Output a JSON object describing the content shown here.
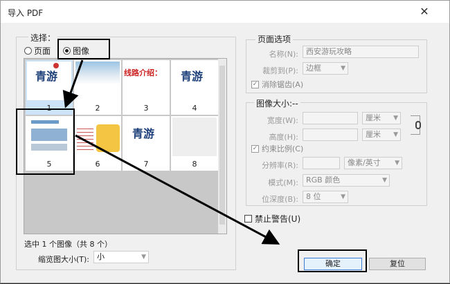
{
  "window": {
    "title": "导入 PDF",
    "close": "✕"
  },
  "select": {
    "group_label": "选择：",
    "page_label": "页面",
    "image_label": "图像",
    "image_selected": true
  },
  "thumbnails": [
    {
      "num": "1"
    },
    {
      "num": "2"
    },
    {
      "num": "3"
    },
    {
      "num": "4"
    },
    {
      "num": "5"
    },
    {
      "num": "6"
    },
    {
      "num": "7"
    },
    {
      "num": "8"
    }
  ],
  "thumb_text": {
    "t1": "青游",
    "t3": "线路介绍：",
    "t4": "青游",
    "t7": "青游"
  },
  "status": {
    "selection": "选中 1 个图像（共 8 个）"
  },
  "thumb_size": {
    "label": "缩览图大小(T):",
    "value": "小"
  },
  "page_options": {
    "group_label": "页面选项",
    "name_label": "名称(N):",
    "name_value": "西安游玩攻略",
    "crop_label": "裁剪到(P):",
    "crop_value": "边框",
    "antialias_label": "消除锯齿(A)",
    "antialias_checked": true
  },
  "image_size": {
    "group_label": "图像大小:--",
    "width_label": "宽度(W):",
    "width_value": "",
    "width_unit": "厘米",
    "height_label": "高度(H):",
    "height_value": "",
    "height_unit": "厘米",
    "constrain_label": "约束比例(C)",
    "constrain_checked": true,
    "resolution_label": "分辨率(R):",
    "resolution_value": "",
    "resolution_unit": "像素/英寸",
    "mode_label": "模式(M):",
    "mode_value": "RGB 颜色",
    "depth_label": "位深度(B):",
    "depth_value": "8 位"
  },
  "suppress_warnings": {
    "label": "禁止警告(U)",
    "checked": false
  },
  "buttons": {
    "ok": "确定",
    "reset": "复位"
  }
}
